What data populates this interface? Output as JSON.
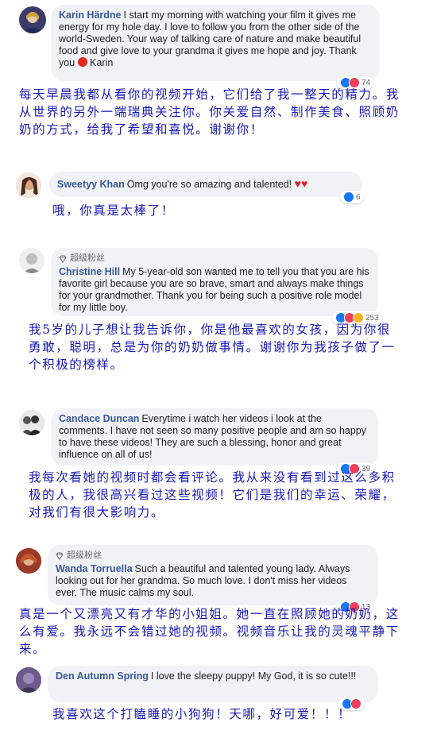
{
  "comments": [
    {
      "author": "Karin Härdne",
      "badge": "",
      "text": "I start my morning with watching your film it gives me energy for my hole day. I love to follow you from the other side of the world-Sweden. Your way of talking care of nature and make beautiful food and give love to your grandma it gives me hope and joy. Thank you",
      "text_tail": " Karin",
      "reaction_count": "74",
      "translation": "每天早晨我都从看你的视频开始，它们给了我一整天的精力。我从世界的另外一端瑞典关注你。你关爱自然、制作美食、照顾奶奶的方式，给我了希望和喜悦。谢谢你！"
    },
    {
      "author": "Sweetyy Khan",
      "badge": "",
      "text": "Omg you're so amazing and talented!",
      "text_tail": "",
      "reaction_count": "6",
      "translation": "哦，你真是太棒了！"
    },
    {
      "author": "Christine Hill",
      "badge": "超级粉丝",
      "text": "My 5-year-old son wanted me to tell you that you are his favorite girl because you are so brave, smart and always make things for your grandmother. Thank you for being such a positive role model for my little boy.",
      "text_tail": "",
      "reaction_count": "253",
      "translation": "我5岁的儿子想让我告诉你，你是他最喜欢的女孩，因为你很勇敢，聪明，总是为你的奶奶做事情。谢谢你为我孩子做了一个积极的榜样。"
    },
    {
      "author": "Candace Duncan",
      "badge": "",
      "text": "Everytime i watch her videos i look at the comments. I have not seen so many positive people and am so happy to have these videos! They are such a blessing, honor and great influence on all of us!",
      "text_tail": "",
      "reaction_count": "39",
      "translation": "我每次看她的视频时都会看评论。我从来没有看到过这么多积极的人，我很高兴看过这些视频！它们是我们的幸运、荣耀，对我们有很大影响力。"
    },
    {
      "author": "Wanda Torruella",
      "badge": "超级粉丝",
      "text": "Such a beautiful and talented young lady. Always looking out for her grandma. So much love. I don't miss her videos ever. The music calms my soul.",
      "text_tail": "",
      "reaction_count": "13",
      "translation": "真是一个又漂亮又有才华的小姐姐。她一直在照顾她的奶奶，这么有爱。我永远不会错过她的视频。视频音乐让我的灵魂平静下来。"
    },
    {
      "author": "Den Autumn Spring",
      "badge": "",
      "text": "I love the sleepy puppy! My God, it is so cute!!!",
      "text_tail": "",
      "reaction_count": "",
      "translation": "我喜欢这个打瞌睡的小狗狗！天哪，好可爱！！！"
    }
  ],
  "colors": {
    "author_link": "#385898",
    "translation_text": "#1a1ab5",
    "bubble_bg": "#f0f2f5"
  },
  "icons": [
    "diamond-badge-icon",
    "like-reaction-icon",
    "love-reaction-icon",
    "wow-reaction-icon",
    "heart-emoji-icon",
    "flower-emoji-icon"
  ]
}
